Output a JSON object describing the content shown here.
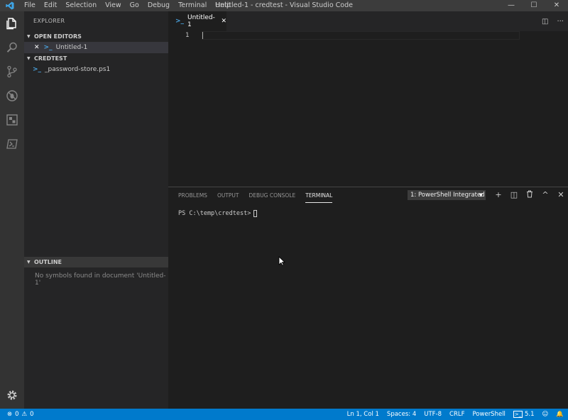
{
  "titlebar": {
    "menu": [
      "File",
      "Edit",
      "Selection",
      "View",
      "Go",
      "Debug",
      "Terminal",
      "Help"
    ],
    "window_title": "Untitled-1 - credtest - Visual Studio Code",
    "controls": {
      "minimize": "—",
      "maximize": "☐",
      "close": "✕"
    }
  },
  "activity_bar": [
    "explorer-icon",
    "search-icon",
    "source-control-icon",
    "debug-icon",
    "extensions-icon",
    "powershell-icon",
    "gear-icon"
  ],
  "sidebar": {
    "title": "EXPLORER",
    "open_editors": {
      "label": "OPEN EDITORS",
      "items": [
        {
          "close": "✕",
          "name": "Untitled-1"
        }
      ]
    },
    "workspace": {
      "label": "CREDTEST",
      "items": [
        {
          "name": "_password-store.ps1"
        }
      ]
    },
    "outline": {
      "label": "OUTLINE",
      "message": "No symbols found in document 'Untitled-1'"
    }
  },
  "editor": {
    "tab": {
      "label": "Untitled-1",
      "close": "✕"
    },
    "actions": {
      "split": "◫",
      "more": "···"
    },
    "line_numbers": [
      "1"
    ]
  },
  "panel": {
    "tabs": [
      "PROBLEMS",
      "OUTPUT",
      "DEBUG CONSOLE",
      "TERMINAL"
    ],
    "active_tab": "TERMINAL",
    "terminal_select": "1: PowerShell Integrated",
    "caret": "▼",
    "actions": {
      "add": "+",
      "split": "◫",
      "trash": "🗑",
      "maximize": "^",
      "close": "✕"
    },
    "prompt": "PS C:\\temp\\credtest>"
  },
  "statusbar": {
    "errors": "0",
    "warnings": "0",
    "position": "Ln 1, Col 1",
    "spaces": "Spaces: 4",
    "encoding": "UTF-8",
    "eol": "CRLF",
    "language": "PowerShell",
    "ps_version": "5.1",
    "feedback": "☺",
    "bell": "🔔"
  },
  "colors": {
    "statusbar": "#007acc",
    "activity_bar": "#333333",
    "sidebar": "#252526",
    "editor": "#1e1e1e",
    "accent_icon": "#4aa3df"
  }
}
